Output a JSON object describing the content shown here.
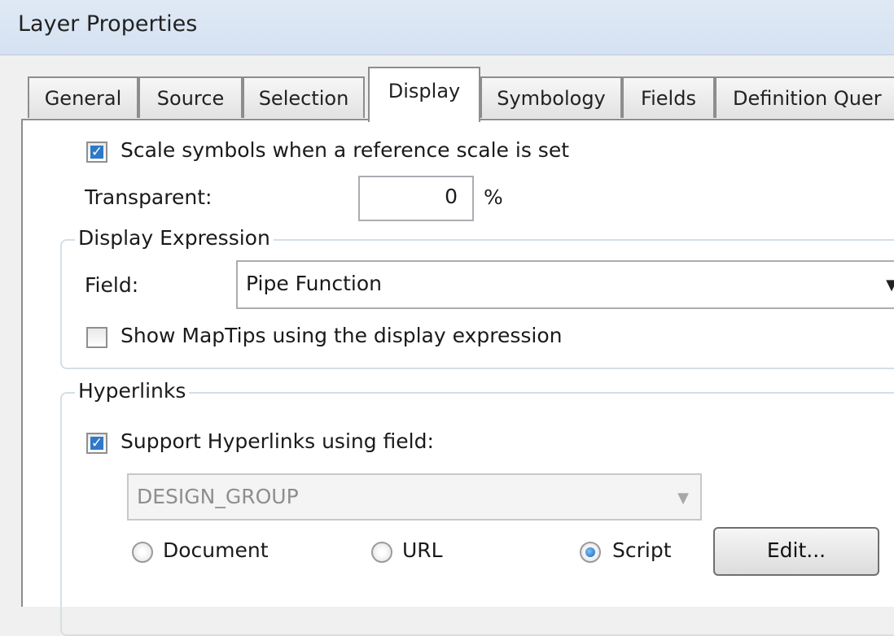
{
  "window": {
    "title": "Layer Properties"
  },
  "tabs": [
    {
      "label": "General"
    },
    {
      "label": "Source"
    },
    {
      "label": "Selection"
    },
    {
      "label": "Display",
      "active": true
    },
    {
      "label": "Symbology"
    },
    {
      "label": "Fields"
    },
    {
      "label": "Definition Quer"
    }
  ],
  "display": {
    "scale_symbols": {
      "label": "Scale symbols when a reference scale is set",
      "checked": true
    },
    "transparent": {
      "label": "Transparent:",
      "value": "0",
      "unit": "%"
    }
  },
  "display_expression": {
    "legend": "Display Expression",
    "field_label": "Field:",
    "field_value": "Pipe Function",
    "maptips": {
      "label": "Show MapTips using the display expression",
      "checked": false
    }
  },
  "hyperlinks": {
    "legend": "Hyperlinks",
    "support": {
      "label": "Support Hyperlinks using field:",
      "checked": true
    },
    "field_value": "DESIGN_GROUP",
    "options": [
      {
        "label": "Document",
        "checked": false
      },
      {
        "label": "URL",
        "checked": false
      },
      {
        "label": "Script",
        "checked": true
      }
    ],
    "edit_button": "Edit..."
  },
  "icons": {
    "checkbox_mark": "check-icon",
    "dropdown": "chevron-down-icon"
  }
}
